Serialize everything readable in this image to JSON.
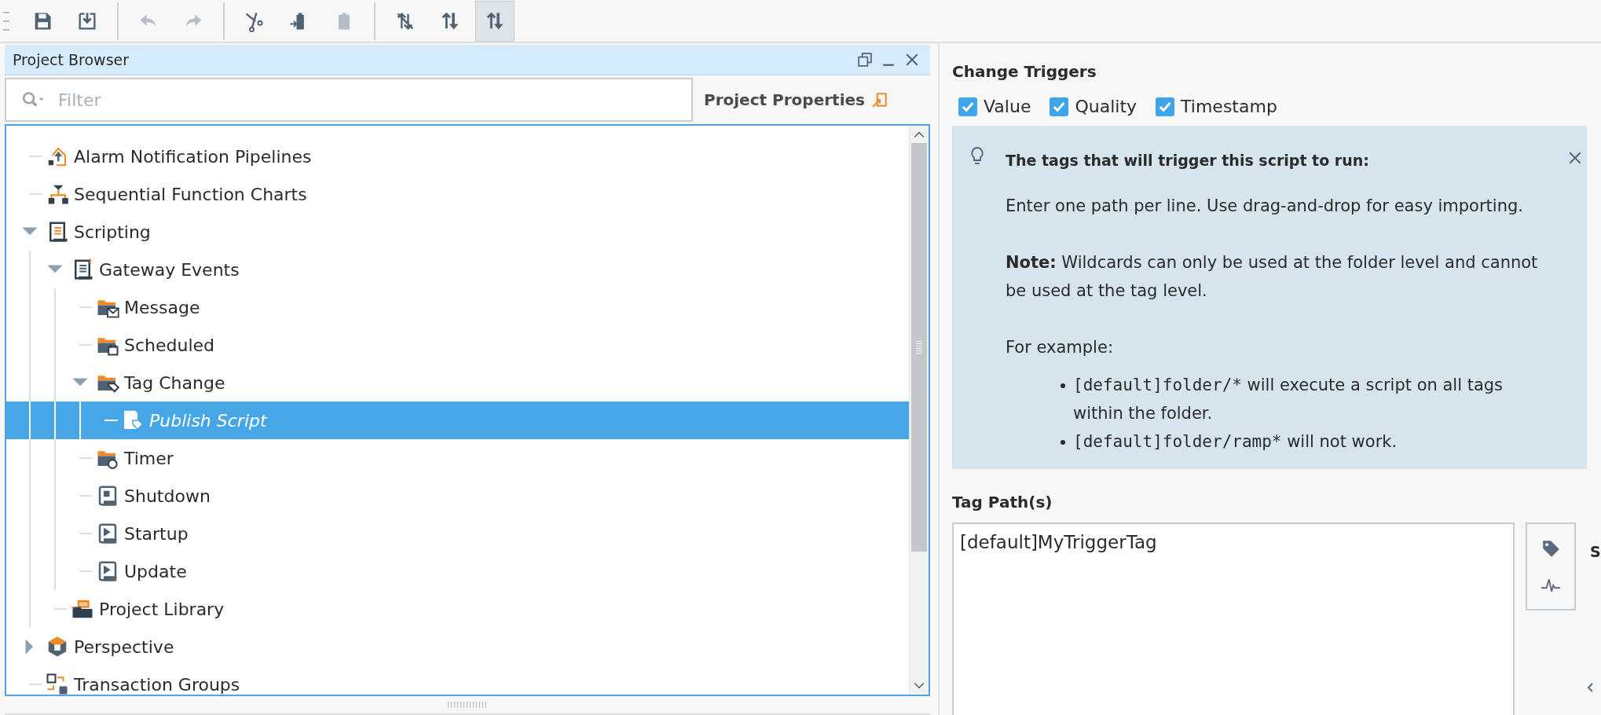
{
  "toolbar_groups": [
    {
      "buttons": [
        {
          "kind": "save",
          "disabled": false,
          "selected": false
        },
        {
          "kind": "export",
          "disabled": false,
          "selected": false
        }
      ]
    },
    {
      "buttons": [
        {
          "kind": "undo",
          "disabled": true,
          "selected": false
        },
        {
          "kind": "redo",
          "disabled": true,
          "selected": false
        }
      ]
    },
    {
      "buttons": [
        {
          "kind": "cut",
          "disabled": false,
          "selected": false
        },
        {
          "kind": "paste-into",
          "disabled": false,
          "selected": false
        },
        {
          "kind": "paste",
          "disabled": true,
          "selected": false
        }
      ]
    },
    {
      "buttons": [
        {
          "kind": "sort-off",
          "disabled": false,
          "selected": false
        },
        {
          "kind": "sort-up",
          "disabled": false,
          "selected": false
        },
        {
          "kind": "sort-down",
          "disabled": false,
          "selected": true
        }
      ]
    }
  ],
  "project_browser": {
    "title": "Project Browser",
    "filter": {
      "placeholder": "Filter"
    },
    "properties_button": "Project Properties",
    "tree": [
      {
        "kind": "alarm",
        "label": "Alarm Notification Pipelines",
        "selected": false,
        "modified": false
      },
      {
        "kind": "sfc",
        "label": "Sequential Function Charts",
        "selected": false,
        "modified": false
      },
      {
        "kind": "scripting",
        "label": "Scripting",
        "selected": false,
        "modified": false,
        "expanded": true,
        "children": [
          {
            "kind": "gateway",
            "label": "Gateway Events",
            "selected": false,
            "modified": false,
            "expanded": true,
            "children": [
              {
                "kind": "message",
                "label": "Message",
                "selected": false,
                "modified": false
              },
              {
                "kind": "scheduled",
                "label": "Scheduled",
                "selected": false,
                "modified": false
              },
              {
                "kind": "tagchange",
                "label": "Tag Change",
                "selected": false,
                "modified": false,
                "expanded": true,
                "children": [
                  {
                    "kind": "tagscript",
                    "label": "Publish Script",
                    "selected": true,
                    "modified": true
                  }
                ]
              },
              {
                "kind": "timer",
                "label": "Timer",
                "selected": false,
                "modified": false
              },
              {
                "kind": "stop",
                "label": "Shutdown",
                "selected": false,
                "modified": false
              },
              {
                "kind": "play",
                "label": "Startup",
                "selected": false,
                "modified": false
              },
              {
                "kind": "play",
                "label": "Update",
                "selected": false,
                "modified": false
              }
            ]
          },
          {
            "kind": "library",
            "label": "Project Library",
            "selected": false,
            "modified": false
          }
        ]
      },
      {
        "kind": "perspective",
        "label": "Perspective",
        "selected": false,
        "modified": false,
        "expanded": false
      },
      {
        "kind": "transaction",
        "label": "Transaction Groups",
        "selected": false,
        "modified": false
      }
    ]
  },
  "change_triggers": {
    "title": "Change Triggers",
    "options": [
      {
        "label": "Value",
        "checked": true
      },
      {
        "label": "Quality",
        "checked": true
      },
      {
        "label": "Timestamp",
        "checked": true
      }
    ]
  },
  "info": {
    "title": "The tags that will trigger this script to run:",
    "paragraphs": [
      "Enter one path per line. Use drag-and-drop for easy importing.",
      "**Note:** Wildcards can only be used at the folder level and cannot be used at the tag level.",
      "For example:"
    ],
    "examples": [
      {
        "code": "[default]folder/*",
        "text": "will execute a script on all tags within the folder."
      },
      {
        "code": "[default]folder/ramp*",
        "text": "will not work."
      }
    ]
  },
  "tag_paths": {
    "label": "Tag Path(s)",
    "value": "[default]MyTriggerTag"
  },
  "side_label": "S"
}
